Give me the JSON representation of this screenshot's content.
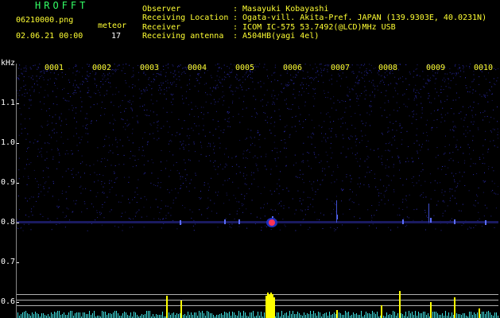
{
  "header": {
    "app_title": "HROFFT",
    "file_name": "06210000.png",
    "date_time": "02.06.21 00:00",
    "meteor_label": "meteor",
    "meteor_count": "17"
  },
  "info": {
    "rows": [
      {
        "label": "Observer",
        "value": ": Masayuki Kobayashi"
      },
      {
        "label": "Receiving Location",
        "value": ": Ogata-vill. Akita-Pref. JAPAN (139.9303E, 40.0231N)"
      },
      {
        "label": "Receiver",
        "value": ": ICOM IC-575 53.7492(@LCD)MHz USB"
      },
      {
        "label": "Receiving antenna",
        "value": ": A504HB(yagi 4el)"
      }
    ]
  },
  "spectrogram": {
    "unit": "kHz",
    "y_ticks": [
      "1.1",
      "1.0",
      "0.9",
      "0.8",
      "0.7",
      "0.6"
    ],
    "minute_labels": [
      "0001",
      "0002",
      "0003",
      "0004",
      "0005",
      "0006",
      "0007",
      "0008",
      "0009",
      "0010"
    ],
    "echo_frequency_khz": 0.8,
    "colors": {
      "background": "#000000",
      "noise": "#2020a0",
      "echo": "#ff3355",
      "activity": "#ffff00",
      "baseline": "#40e0e0"
    }
  }
}
